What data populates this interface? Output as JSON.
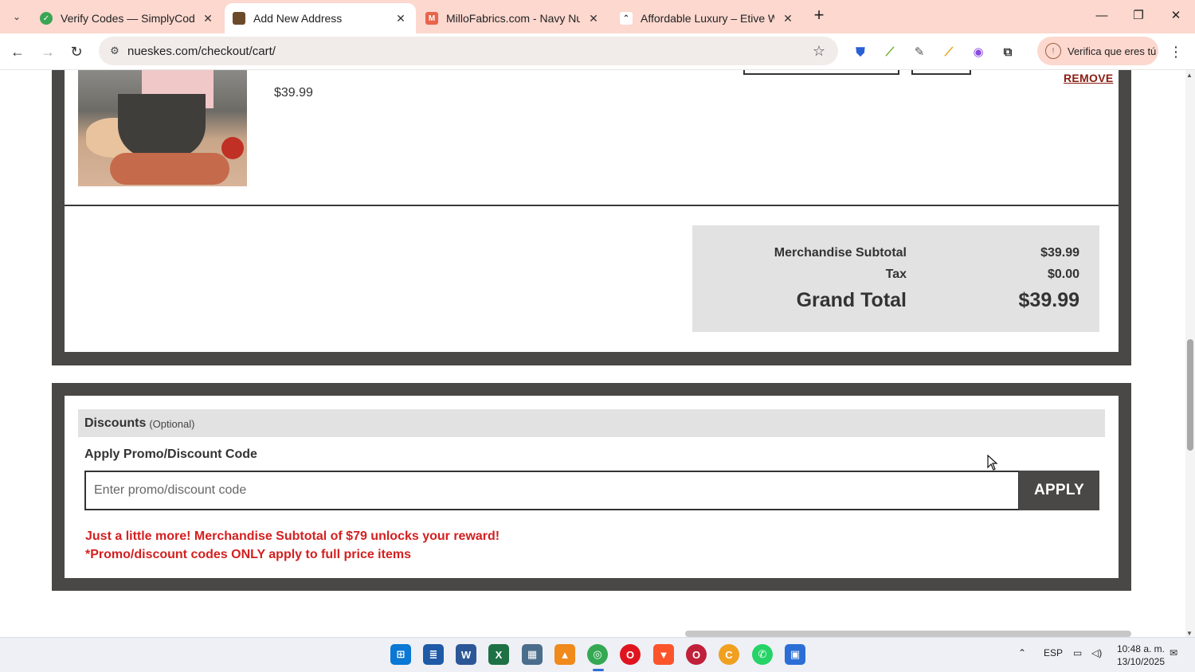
{
  "browser": {
    "tabs": [
      {
        "title": "Verify Codes — SimplyCodes",
        "favicon_color": "#3aa655"
      },
      {
        "title": "Add New Address",
        "favicon_color": "#6b4a2a"
      },
      {
        "title": "MilloFabrics.com - Navy Nude",
        "favicon_color": "#e8644a"
      },
      {
        "title": "Affordable Luxury – Etive Watch",
        "favicon_color": "#222222"
      }
    ],
    "url": "nueskes.com/checkout/cart/",
    "profile_chip": "Verifica que eres tú"
  },
  "cart": {
    "item_price": "$39.99",
    "remove_label": "REMOVE"
  },
  "totals": {
    "subtotal_label": "Merchandise Subtotal",
    "subtotal_value": "$39.99",
    "tax_label": "Tax",
    "tax_value": "$0.00",
    "grand_label": "Grand Total",
    "grand_value": "$39.99"
  },
  "discounts": {
    "heading": "Discounts",
    "optional": "(Optional)",
    "promo_label": "Apply Promo/Discount Code",
    "promo_placeholder": "Enter promo/discount code",
    "apply_label": "APPLY",
    "message_1": "Just a little more! Merchandise Subtotal of $79 unlocks your reward!",
    "message_2": "*Promo/discount codes ONLY apply to full price items"
  },
  "taskbar": {
    "language": "ESP",
    "time": "10:48 a. m.",
    "date": "13/10/2025"
  },
  "colors": {
    "tabstrip": "#fcd8cf",
    "panel_frame": "#4a4846",
    "totals_bg": "#e2e2e2",
    "accent_red": "#d42020",
    "remove_link": "#8a1c12"
  }
}
